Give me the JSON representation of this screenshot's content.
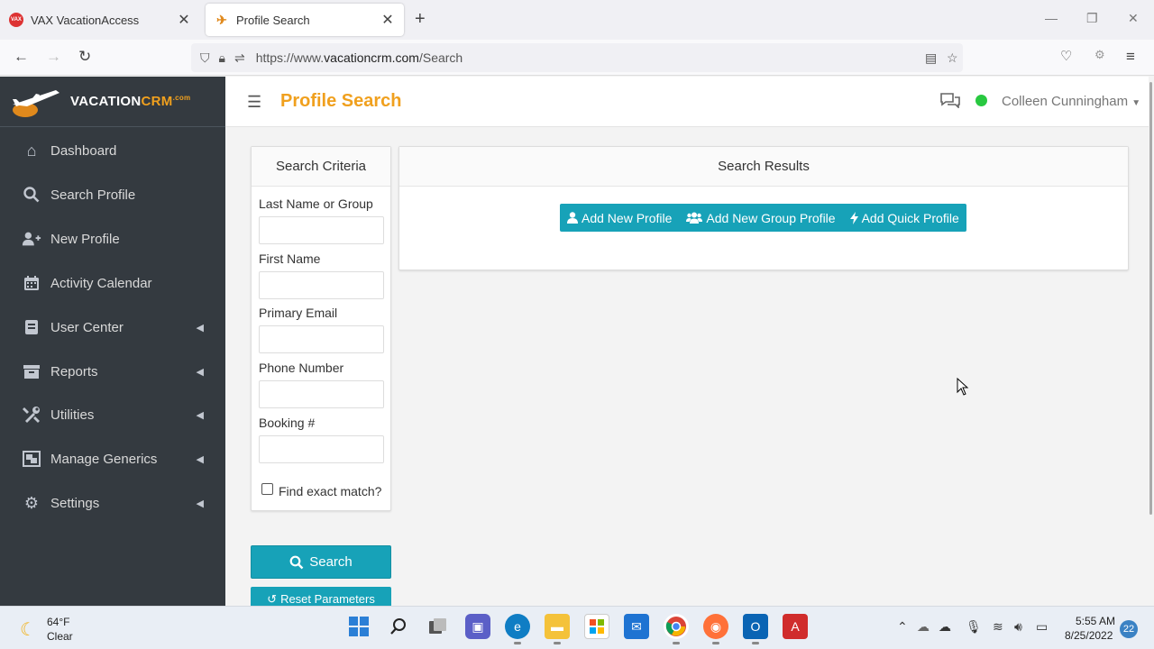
{
  "browser": {
    "tabs": [
      {
        "title": "VAX VacationAccess",
        "favicon": "vax-logo-icon",
        "active": false
      },
      {
        "title": "Profile Search",
        "favicon": "plane-logo-icon",
        "active": true
      }
    ],
    "url_prefix": "https://www.",
    "url_host": "vacationcrm.com",
    "url_path": "/Search"
  },
  "app": {
    "brand_main": "VACATION",
    "brand_accent": "CRM",
    "brand_suffix": ".com",
    "page_title": "Profile Search",
    "user_name": "Colleen Cunningham",
    "status_color": "#28c840",
    "accent_color": "#f0a01e",
    "button_color": "#17a2b8"
  },
  "sidebar": {
    "items": [
      {
        "label": "Dashboard",
        "icon": "home-icon",
        "has_submenu": false
      },
      {
        "label": "Search Profile",
        "icon": "search-icon",
        "has_submenu": false
      },
      {
        "label": "New Profile",
        "icon": "user-plus-icon",
        "has_submenu": false
      },
      {
        "label": "Activity Calendar",
        "icon": "calendar-icon",
        "has_submenu": false
      },
      {
        "label": "User Center",
        "icon": "book-icon",
        "has_submenu": true
      },
      {
        "label": "Reports",
        "icon": "archive-icon",
        "has_submenu": true
      },
      {
        "label": "Utilities",
        "icon": "tools-icon",
        "has_submenu": true
      },
      {
        "label": "Manage Generics",
        "icon": "object-group-icon",
        "has_submenu": true
      },
      {
        "label": "Settings",
        "icon": "gear-icon",
        "has_submenu": true
      }
    ]
  },
  "criteria": {
    "heading": "Search Criteria",
    "fields": [
      {
        "label": "Last Name or Group",
        "value": ""
      },
      {
        "label": "First Name",
        "value": ""
      },
      {
        "label": "Primary Email",
        "value": ""
      },
      {
        "label": "Phone Number",
        "value": ""
      },
      {
        "label": "Booking #",
        "value": ""
      }
    ],
    "exact_match_label": "Find exact match?",
    "exact_match_checked": false,
    "search_button": "Search",
    "reset_button": "Reset Parameters"
  },
  "results": {
    "heading": "Search Results",
    "buttons": [
      {
        "label": "Add New Profile",
        "icon": "user-icon"
      },
      {
        "label": "Add New Group Profile",
        "icon": "users-icon"
      },
      {
        "label": "Add Quick Profile",
        "icon": "bolt-icon"
      }
    ]
  },
  "taskbar": {
    "weather_temp": "64°F",
    "weather_condition": "Clear",
    "time": "5:55 AM",
    "date": "8/25/2022",
    "notifications": "22"
  }
}
